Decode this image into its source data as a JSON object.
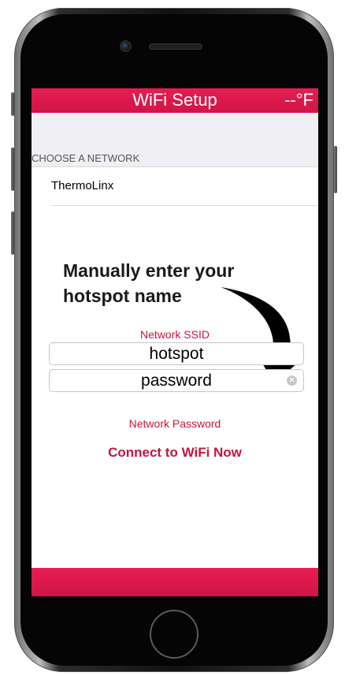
{
  "navbar": {
    "title": "WiFi Setup",
    "temperature": "--°F"
  },
  "network_list": {
    "section_header": "CHOOSE A NETWORK",
    "items": [
      {
        "label": "ThermoLinx"
      }
    ]
  },
  "annotation": {
    "line1": "Manually enter your",
    "line2": "hotspot name"
  },
  "form": {
    "ssid_label": "Network SSID",
    "ssid_value": "hotspot",
    "password_value": "password",
    "password_label": "Network Password",
    "connect_label": "Connect to WiFi Now"
  },
  "colors": {
    "accent": "#d11446",
    "link": "#c8143c",
    "annotation_arrow": "#000000"
  },
  "icons": {
    "clear": "clear-circle-icon",
    "arrow": "curved-arrow-icon"
  }
}
